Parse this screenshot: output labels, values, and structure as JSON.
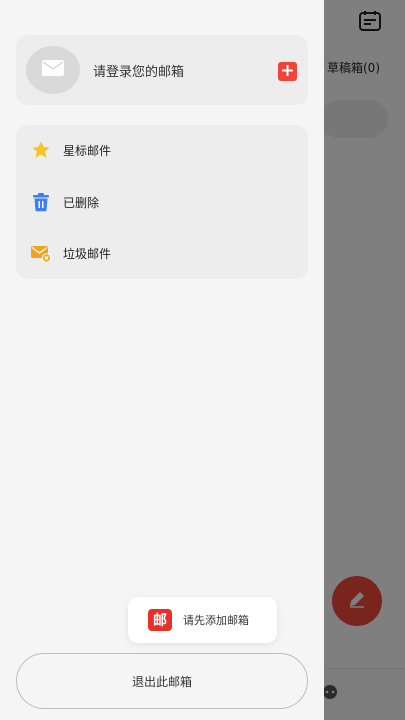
{
  "background": {
    "drafts_tab": "草稿箱(0)"
  },
  "drawer": {
    "account": {
      "login_prompt": "请登录您的邮箱"
    },
    "folders": [
      {
        "label": "星标邮件",
        "icon": "star-icon"
      },
      {
        "label": "已删除",
        "icon": "trash-icon"
      },
      {
        "label": "垃圾邮件",
        "icon": "spam-icon"
      }
    ],
    "toast": {
      "logo_text": "邮",
      "message": "请先添加邮箱"
    },
    "logout_label": "退出此邮箱"
  },
  "colors": {
    "accent_red": "#f04436",
    "star_yellow": "#f7c325",
    "trash_blue": "#3d7ff0",
    "spam_orange": "#f3a321"
  }
}
